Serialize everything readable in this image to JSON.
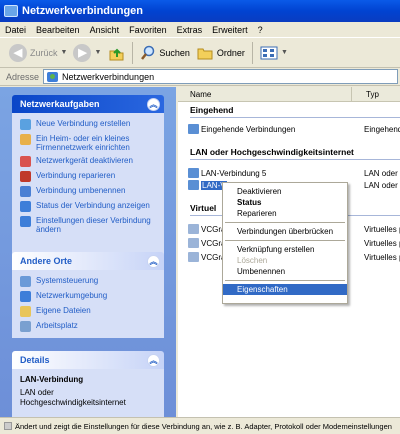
{
  "window": {
    "title": "Netzwerkverbindungen"
  },
  "menu": [
    "Datei",
    "Bearbeiten",
    "Ansicht",
    "Favoriten",
    "Extras",
    "Erweitert",
    "?"
  ],
  "toolbar": {
    "back": "Zurück",
    "search": "Suchen",
    "folders": "Ordner"
  },
  "address": {
    "label": "Adresse",
    "value": "Netzwerkverbindungen"
  },
  "tasks": {
    "title": "Netzwerkaufgaben",
    "items": [
      "Neue Verbindung erstellen",
      "Ein Heim- oder ein kleines Firmennetzwerk einrichten",
      "Netzwerkgerät deaktivieren",
      "Verbindung reparieren",
      "Verbindung umbenennen",
      "Status der Verbindung anzeigen",
      "Einstellungen dieser Verbindung ändern"
    ]
  },
  "other": {
    "title": "Andere Orte",
    "items": [
      "Systemsteuerung",
      "Netzwerkumgebung",
      "Eigene Dateien",
      "Arbeitsplatz"
    ]
  },
  "details": {
    "title": "Details",
    "name": "LAN-Verbindung",
    "text": "LAN oder Hochgeschwindigkeitsinternet"
  },
  "columns": {
    "name": "Name",
    "type": "Typ"
  },
  "groups": {
    "incoming": "Eingehend",
    "lan": "LAN oder Hochgeschwindigkeitsinternet",
    "virtual": "Virtuel"
  },
  "rows": {
    "incoming1": {
      "name": "Eingehende Verbindungen",
      "type": "Eingehende"
    },
    "lan5": {
      "name": "LAN-Verbindung 5",
      "type": "LAN oder"
    },
    "lanSel": {
      "name": "LAN-V",
      "type": "LAN oder"
    },
    "v1": {
      "name": "VCGra",
      "type": "Virtuelles p"
    },
    "v2": {
      "name": "VCGra",
      "type": "Virtuelles p"
    },
    "v3": {
      "name": "VCGra",
      "type": "Virtuelles p"
    }
  },
  "context_menu": {
    "items": [
      "Deaktivieren",
      "Status",
      "Reparieren",
      "Verbindungen überbrücken",
      "Verknüpfung erstellen",
      "Löschen",
      "Umbenennen",
      "Eigenschaften"
    ]
  },
  "status": {
    "text": "Ändert und zeigt die Einstellungen für diese Verbindung an, wie z. B. Adapter, Protokoll oder Modemeinstellungen"
  },
  "colors": {
    "title": "#0143d1",
    "taskpane": "#7ba4e3",
    "selection": "#316ac5"
  }
}
